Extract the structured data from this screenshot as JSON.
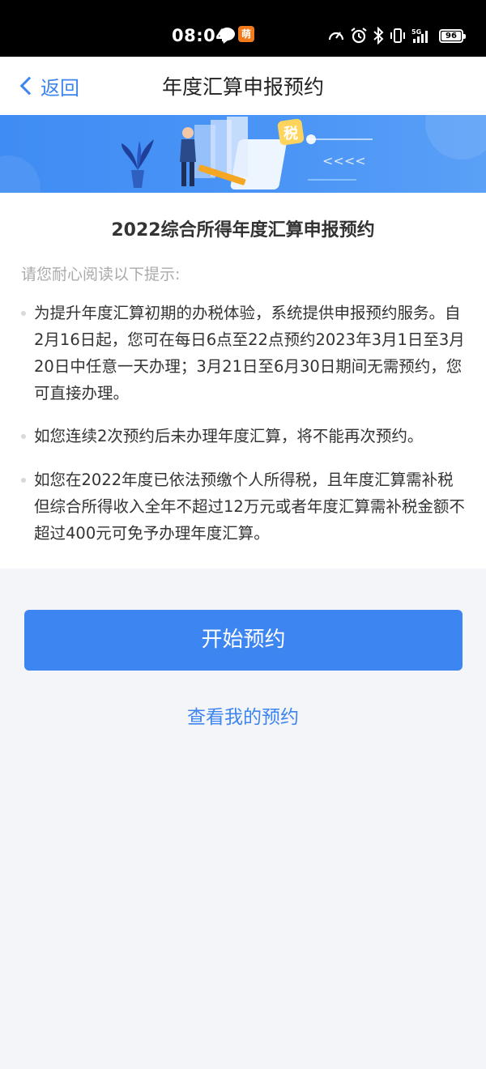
{
  "status_bar": {
    "time": "08:04",
    "app_badge": "萌",
    "battery": "96"
  },
  "nav": {
    "back_label": "返回",
    "title": "年度汇算申报预约"
  },
  "banner": {
    "tax_badge": "税",
    "arrows": "<<<<"
  },
  "content": {
    "title": "2022综合所得年度汇算申报预约",
    "intro": "请您耐心阅读以下提示:",
    "tips": [
      "为提升年度汇算初期的办税体验，系统提供申报预约服务。自2月16日起，您可在每日6点至22点预约2023年3月1日至3月20日中任意一天办理；3月21日至6月30日期间无需预约，您可直接办理。",
      "如您连续2次预约后未办理年度汇算，将不能再次预约。",
      "如您在2022年度已依法预缴个人所得税，且年度汇算需补税但综合所得收入全年不超过12万元或者年度汇算需补税金额不超过400元可免予办理年度汇算。"
    ]
  },
  "actions": {
    "start_label": "开始预约",
    "view_label": "查看我的预约"
  },
  "colors": {
    "accent": "#3d85f0",
    "banner": "#4b95f6",
    "page_bg": "#f4f5f9"
  }
}
